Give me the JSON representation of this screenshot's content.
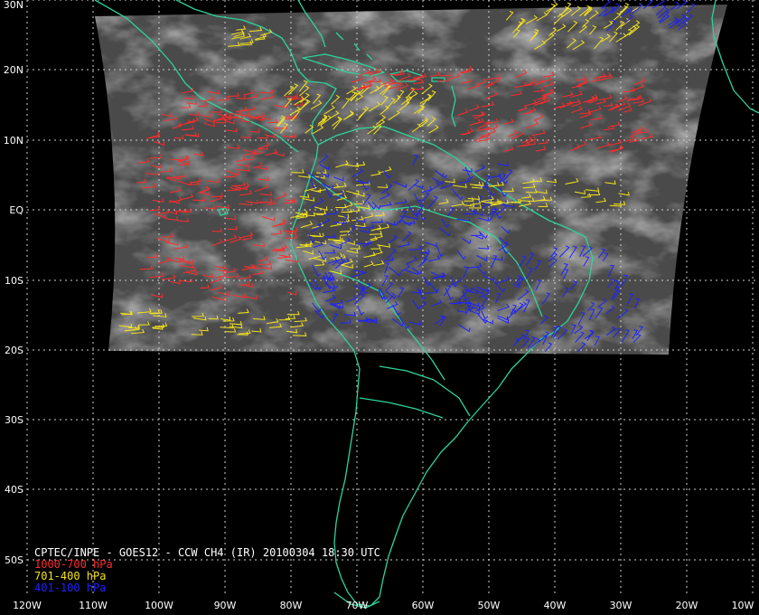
{
  "colors": {
    "background": "#000000",
    "grid": "#cfcfcf",
    "coastline": "#2ed39b",
    "label": "#ffffff",
    "wind_low": "#ff2a2a",
    "wind_mid": "#f5e31c",
    "wind_high": "#1e22ff"
  },
  "grid": {
    "latitude_labels": [
      "30N",
      "20N",
      "10N",
      "EQ",
      "10S",
      "20S",
      "30S",
      "40S",
      "50S"
    ],
    "longitude_labels": [
      "120W",
      "110W",
      "100W",
      "90W",
      "80W",
      "70W",
      "60W",
      "50W",
      "40W",
      "30W",
      "20W",
      "10W"
    ]
  },
  "caption": {
    "title": "CPTEC/INPE - GOES12 - CCW CH4 (IR) 20100304 18:30 UTC",
    "legend": [
      {
        "label": "1000-700 hPa",
        "color": "#ff2a2a"
      },
      {
        "label": "701-400 hPa",
        "color": "#f5e31c"
      },
      {
        "label": "401-100 hPa",
        "color": "#1e22ff"
      }
    ]
  },
  "icons": [
    "wind-barb-icon"
  ]
}
